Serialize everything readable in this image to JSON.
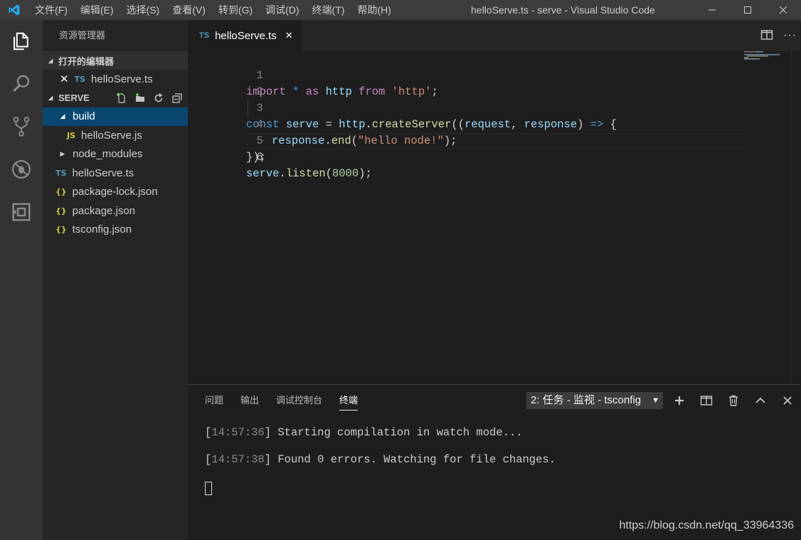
{
  "titlebar": {
    "menu": [
      "文件(F)",
      "编辑(E)",
      "选择(S)",
      "查看(V)",
      "转到(G)",
      "调试(D)",
      "终端(T)",
      "帮助(H)"
    ],
    "window_title": "helloServe.ts - serve - Visual Studio Code"
  },
  "sidebar": {
    "title": "资源管理器",
    "open_editors_label": "打开的编辑器",
    "open_editor_file": "helloServe.ts",
    "open_editor_badge": "TS",
    "folder_label": "SERVE",
    "tree": [
      {
        "name": "build",
        "type": "folder",
        "badge": ""
      },
      {
        "name": "helloServe.js",
        "type": "js",
        "badge": "JS"
      },
      {
        "name": "node_modules",
        "type": "folder",
        "badge": ""
      },
      {
        "name": "helloServe.ts",
        "type": "ts",
        "badge": "TS"
      },
      {
        "name": "package-lock.json",
        "type": "json",
        "badge": "{}"
      },
      {
        "name": "package.json",
        "type": "json",
        "badge": "{}"
      },
      {
        "name": "tsconfig.json",
        "type": "json",
        "badge": "{}"
      }
    ]
  },
  "editor": {
    "tab_label": "helloServe.ts",
    "tab_badge": "TS",
    "line_numbers": [
      "1",
      "2",
      "3",
      "4",
      "5",
      "6"
    ],
    "code": {
      "l1": {
        "a": "import",
        "b": " * ",
        "c": "as",
        "d": " http ",
        "e": "from",
        "f": " ",
        "g": "'http'",
        "h": ";"
      },
      "l3": {
        "a": "const",
        "b": " serve",
        "c": " = ",
        "d": "http",
        "e": ".",
        "f": "createServer",
        "g": "((",
        "h": "request",
        "i": ", ",
        "j": "response",
        "k": ") ",
        "l": "=>",
        "m": " {"
      },
      "l4": {
        "a": "response",
        "b": ".",
        "c": "end",
        "d": "(",
        "e": "\"hello node!\"",
        "f": ");"
      },
      "l5": {
        "a": "});"
      },
      "l6": {
        "a": "serve",
        "b": ".",
        "c": "listen",
        "d": "(",
        "e": "8000",
        "f": ");"
      }
    }
  },
  "panel": {
    "tabs": [
      "问题",
      "输出",
      "调试控制台",
      "终端"
    ],
    "active_tab": "终端",
    "terminal_select": "2: 任务 - 监视 - tsconfig",
    "terminal_lines": [
      {
        "time": "14:57:36",
        "text": "Starting compilation in watch mode..."
      },
      {
        "time": "14:57:38",
        "text": "Found 0 errors. Watching for file changes."
      }
    ]
  },
  "watermark": "https://blog.csdn.net/qq_33964336",
  "colors": {
    "accent": "#007acc",
    "selection": "#094771",
    "ts_icon": "#519aba",
    "json_icon": "#cbcb41"
  }
}
